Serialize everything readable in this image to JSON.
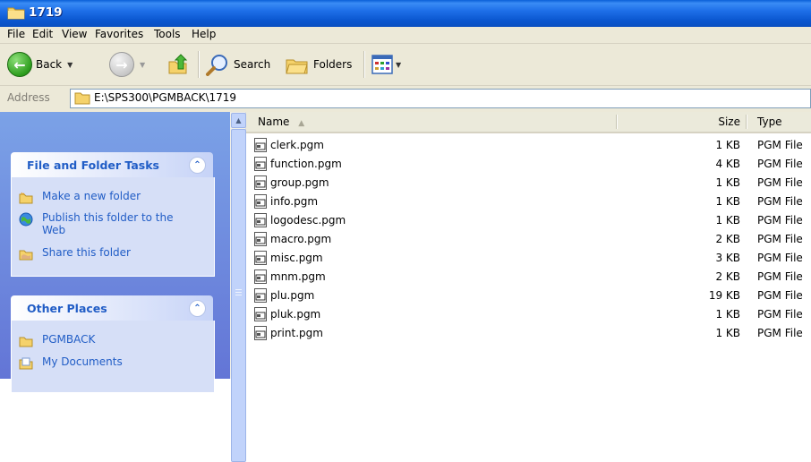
{
  "window": {
    "title": "1719"
  },
  "menu": [
    "File",
    "Edit",
    "View",
    "Favorites",
    "Tools",
    "Help"
  ],
  "toolbar": {
    "back_label": "Back",
    "search_label": "Search",
    "folders_label": "Folders"
  },
  "address": {
    "label": "Address",
    "value": "E:\\SPS300\\PGMBACK\\1719"
  },
  "tasks_panel": {
    "title": "File and Folder Tasks",
    "items": [
      {
        "label": "Make a new folder",
        "icon": "new-folder-icon"
      },
      {
        "label": "Publish this folder to the Web",
        "icon": "publish-web-icon"
      },
      {
        "label": "Share this folder",
        "icon": "share-folder-icon"
      }
    ]
  },
  "places_panel": {
    "title": "Other Places",
    "items": [
      {
        "label": "PGMBACK",
        "icon": "folder-icon"
      },
      {
        "label": "My Documents",
        "icon": "my-documents-icon"
      }
    ]
  },
  "file_list": {
    "columns": {
      "name": "Name",
      "size": "Size",
      "type": "Type"
    },
    "files": [
      {
        "name": "clerk.pgm",
        "size": "1 KB",
        "type": "PGM File"
      },
      {
        "name": "function.pgm",
        "size": "4 KB",
        "type": "PGM File"
      },
      {
        "name": "group.pgm",
        "size": "1 KB",
        "type": "PGM File"
      },
      {
        "name": "info.pgm",
        "size": "1 KB",
        "type": "PGM File"
      },
      {
        "name": "logodesc.pgm",
        "size": "1 KB",
        "type": "PGM File"
      },
      {
        "name": "macro.pgm",
        "size": "2 KB",
        "type": "PGM File"
      },
      {
        "name": "misc.pgm",
        "size": "3 KB",
        "type": "PGM File"
      },
      {
        "name": "mnm.pgm",
        "size": "2 KB",
        "type": "PGM File"
      },
      {
        "name": "plu.pgm",
        "size": "19 KB",
        "type": "PGM File"
      },
      {
        "name": "pluk.pgm",
        "size": "1 KB",
        "type": "PGM File"
      },
      {
        "name": "print.pgm",
        "size": "1 KB",
        "type": "PGM File"
      }
    ]
  }
}
